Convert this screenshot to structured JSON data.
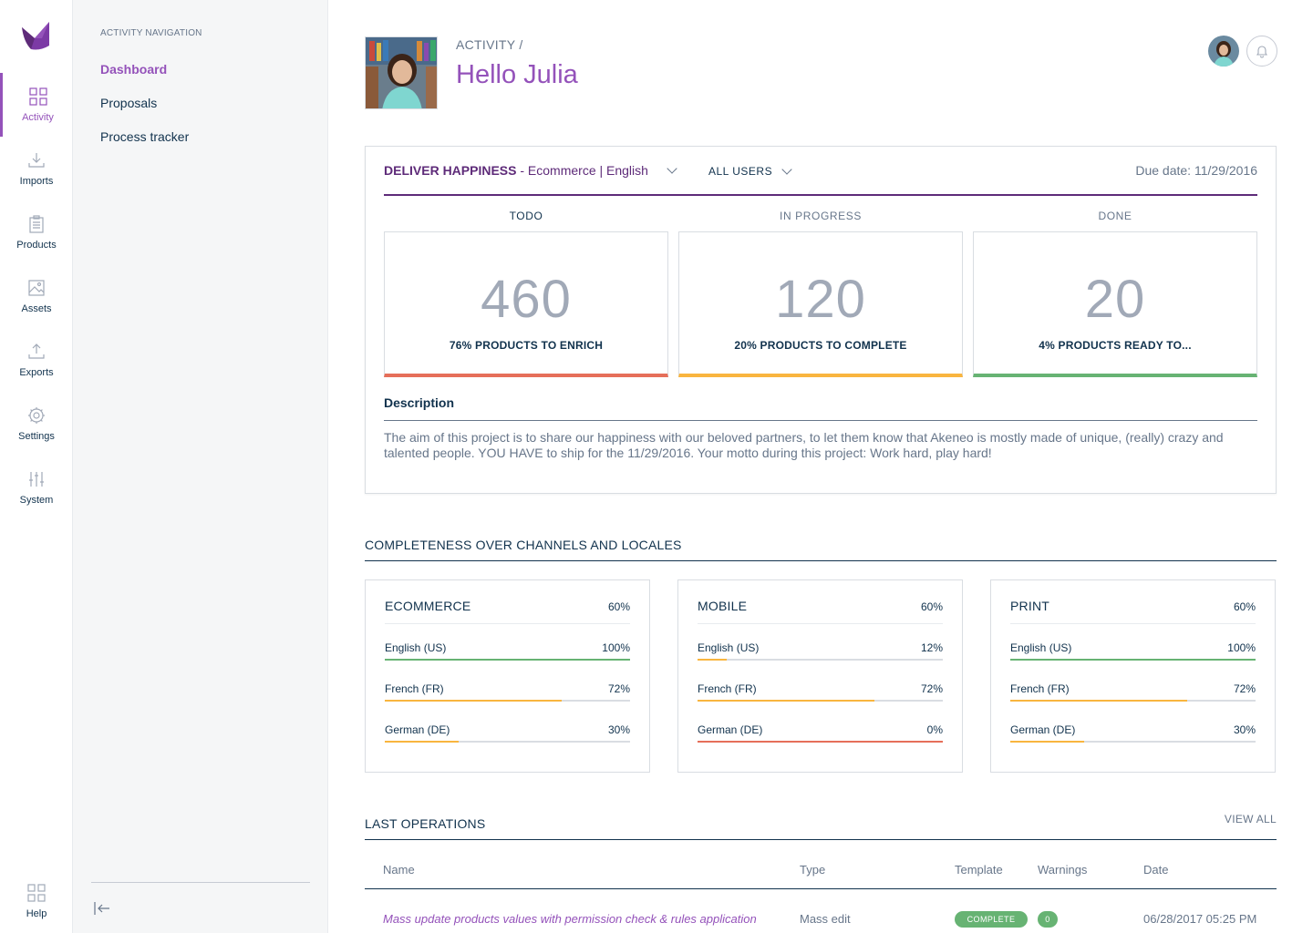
{
  "menu": {
    "items": [
      {
        "label": "Activity",
        "icon": "dashboard-grid-icon"
      },
      {
        "label": "Imports",
        "icon": "import-icon"
      },
      {
        "label": "Products",
        "icon": "clipboard-icon"
      },
      {
        "label": "Assets",
        "icon": "image-icon"
      },
      {
        "label": "Exports",
        "icon": "export-icon"
      },
      {
        "label": "Settings",
        "icon": "gear-icon"
      },
      {
        "label": "System",
        "icon": "sliders-icon"
      }
    ],
    "help": "Help"
  },
  "colnav": {
    "section_title": "ACTIVITY NAVIGATION",
    "links": [
      "Dashboard",
      "Proposals",
      "Process tracker"
    ]
  },
  "header": {
    "breadcrumb": "ACTIVITY  /",
    "title": "Hello Julia"
  },
  "project": {
    "name": "DELIVER HAPPINESS",
    "context": " - Ecommerce | English",
    "users": "ALL USERS",
    "due": "Due date: 11/29/2016",
    "columns": [
      {
        "title": "TODO",
        "count": "460",
        "sub": "76% PRODUCTS TO ENRICH",
        "color": "#e66f5a"
      },
      {
        "title": "IN PROGRESS",
        "count": "120",
        "sub": "20% PRODUCTS TO COMPLETE",
        "color": "#f9b53f"
      },
      {
        "title": "DONE",
        "count": "20",
        "sub": "4% PRODUCTS READY TO...",
        "color": "#67b373"
      }
    ],
    "description_title": "Description",
    "description": "The aim of this project is to share our happiness with our beloved partners, to let them know that Akeneo is mostly made of unique, (really) crazy and talented people. YOU HAVE to ship for the 11/29/2016. Your motto during this project: Work hard, play hard!"
  },
  "completeness": {
    "title": "COMPLETENESS OVER CHANNELS AND LOCALES",
    "channels": [
      {
        "name": "ECOMMERCE",
        "pct": "60%",
        "locales": [
          {
            "name": "English (US)",
            "pct": "100%",
            "ratio": 1.0,
            "color": "#67b373"
          },
          {
            "name": "French (FR)",
            "pct": "72%",
            "ratio": 0.72,
            "color": "#f9b53f"
          },
          {
            "name": "German (DE)",
            "pct": "30%",
            "ratio": 0.3,
            "color": "#f9b53f"
          }
        ]
      },
      {
        "name": "MOBILE",
        "pct": "60%",
        "locales": [
          {
            "name": "English (US)",
            "pct": "12%",
            "ratio": 0.12,
            "color": "#f9b53f"
          },
          {
            "name": "French (FR)",
            "pct": "72%",
            "ratio": 0.72,
            "color": "#f9b53f"
          },
          {
            "name": "German (DE)",
            "pct": "0%",
            "ratio": 1.0,
            "color": "#e66f5a"
          }
        ]
      },
      {
        "name": "PRINT",
        "pct": "60%",
        "locales": [
          {
            "name": "English (US)",
            "pct": "100%",
            "ratio": 1.0,
            "color": "#67b373"
          },
          {
            "name": "French (FR)",
            "pct": "72%",
            "ratio": 0.72,
            "color": "#f9b53f"
          },
          {
            "name": "German (DE)",
            "pct": "30%",
            "ratio": 0.3,
            "color": "#f9b53f"
          }
        ]
      }
    ]
  },
  "operations": {
    "title": "LAST OPERATIONS",
    "view_all": "VIEW ALL",
    "headers": [
      "Name",
      "Type",
      "Template",
      "Warnings",
      "Date"
    ],
    "rows": [
      {
        "name": "Mass update products values with permission check & rules application",
        "type": "Mass edit",
        "template": "COMPLETE",
        "warnings": "0",
        "date": "06/28/2017 05:25 PM"
      }
    ]
  }
}
